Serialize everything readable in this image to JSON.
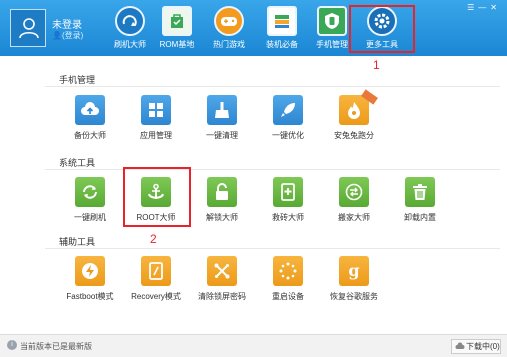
{
  "header": {
    "user_name": "未登录",
    "login_link": "(登录)",
    "nav": [
      {
        "label": "刷机大师"
      },
      {
        "label": "ROM基地"
      },
      {
        "label": "热门游戏"
      },
      {
        "label": "装机必备"
      },
      {
        "label": "手机管理"
      },
      {
        "label": "更多工具"
      }
    ]
  },
  "annotations": {
    "marker_1": "1",
    "marker_2": "2"
  },
  "sections": [
    {
      "title": "手机管理",
      "tiles": [
        {
          "label": "备份大师"
        },
        {
          "label": "应用管理"
        },
        {
          "label": "一键清理"
        },
        {
          "label": "一键优化"
        },
        {
          "label": "安兔兔跑分"
        }
      ]
    },
    {
      "title": "系统工具",
      "tiles": [
        {
          "label": "一键刷机"
        },
        {
          "label": "ROOT大师"
        },
        {
          "label": "解锁大师"
        },
        {
          "label": "救砖大师"
        },
        {
          "label": "搬家大师"
        },
        {
          "label": "卸载内置"
        }
      ]
    },
    {
      "title": "辅助工具",
      "tiles": [
        {
          "label": "Fastboot模式"
        },
        {
          "label": "Recovery模式"
        },
        {
          "label": "清除锁屏密码"
        },
        {
          "label": "重启设备"
        },
        {
          "label": "恢复谷歌服务"
        }
      ]
    }
  ],
  "status": {
    "text": "当前版本已是最新版",
    "download_label": "下载中(0)"
  },
  "colors": {
    "header_blue": "#2a96df",
    "highlight_red": "#e8242b",
    "tile_blue": "#3a96dc",
    "tile_green": "#6cb945",
    "tile_orange": "#f2a62c"
  },
  "icons": [
    "user-icon",
    "refresh-icon",
    "rom-bag-icon",
    "gamepad-icon",
    "books-icon",
    "shield-icon",
    "gear-icon",
    "cloud-upload-icon",
    "grid-icon",
    "broom-icon",
    "rocket-icon",
    "fire-icon",
    "sync-icon",
    "anchor-icon",
    "unlock-icon",
    "phone-plus-icon",
    "swap-icon",
    "trash-icon",
    "lightning-icon",
    "recovery-icon",
    "wrench-icon",
    "sparkle-icon",
    "google-g-icon"
  ]
}
